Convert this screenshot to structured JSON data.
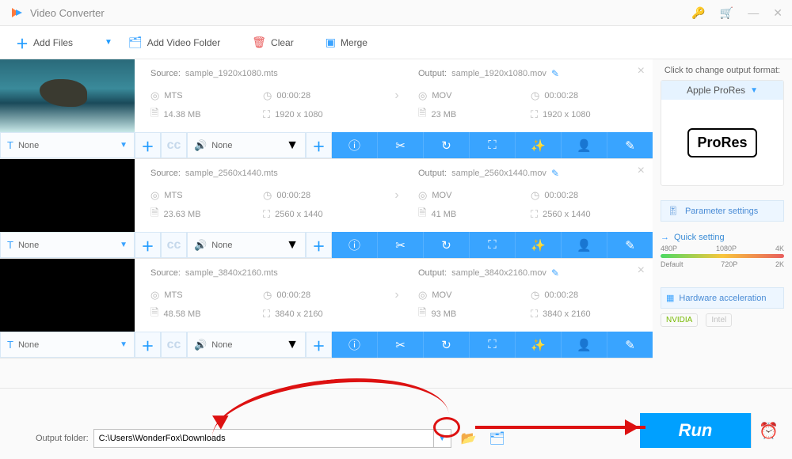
{
  "app_title": "Video Converter",
  "toolbar": {
    "add_files": "Add Files",
    "add_folder": "Add Video Folder",
    "clear": "Clear",
    "merge": "Merge"
  },
  "items": [
    {
      "source_name": "sample_1920x1080.mts",
      "output_name": "sample_1920x1080.mov",
      "src_format": "MTS",
      "out_format": "MOV",
      "src_duration": "00:00:28",
      "out_duration": "00:00:28",
      "src_size": "14.38 MB",
      "out_size": "23 MB",
      "src_res": "1920 x 1080",
      "out_res": "1920 x 1080",
      "subtitle": "None",
      "audio": "None"
    },
    {
      "source_name": "sample_2560x1440.mts",
      "output_name": "sample_2560x1440.mov",
      "src_format": "MTS",
      "out_format": "MOV",
      "src_duration": "00:00:28",
      "out_duration": "00:00:28",
      "src_size": "23.63 MB",
      "out_size": "41 MB",
      "src_res": "2560 x 1440",
      "out_res": "2560 x 1440",
      "subtitle": "None",
      "audio": "None"
    },
    {
      "source_name": "sample_3840x2160.mts",
      "output_name": "sample_3840x2160.mov",
      "src_format": "MTS",
      "out_format": "MOV",
      "src_duration": "00:00:28",
      "out_duration": "00:00:28",
      "src_size": "48.58 MB",
      "out_size": "93 MB",
      "src_res": "3840 x 2160",
      "out_res": "3840 x 2160",
      "subtitle": "None",
      "audio": "None"
    }
  ],
  "labels": {
    "source": "Source:",
    "output": "Output:"
  },
  "side": {
    "click_change": "Click to change output format:",
    "format_name": "Apple ProRes",
    "format_badge": "ProRes",
    "param_settings": "Parameter settings",
    "quick_setting": "Quick setting",
    "slider_top": [
      "480P",
      "1080P",
      "4K"
    ],
    "slider_bottom": [
      "Default",
      "720P",
      "2K"
    ],
    "hw_accel": "Hardware acceleration",
    "nvidia": "NVIDIA",
    "intel": "Intel"
  },
  "footer": {
    "label": "Output folder:",
    "path": "C:\\Users\\WonderFox\\Downloads",
    "run": "Run"
  }
}
